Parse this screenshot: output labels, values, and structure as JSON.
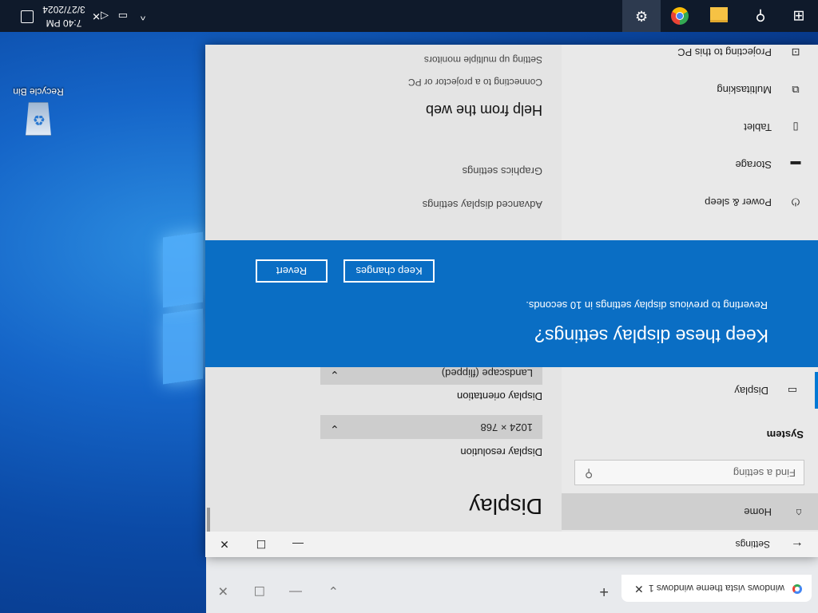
{
  "desktop": {
    "recycle_bin_label": "Recycle Bin"
  },
  "browser": {
    "tab_title": "windows vista theme windows 1(",
    "tab_close_glyph": "✕",
    "new_tab_glyph": "+",
    "controls": {
      "restore_down": "⌄",
      "minimize": "—",
      "maximize": "☐",
      "close": "✕"
    }
  },
  "settings": {
    "title": "Settings",
    "back_glyph": "←",
    "controls": {
      "minimize": "—",
      "maximize": "☐",
      "close": "✕"
    },
    "sidebar": {
      "home": "Home",
      "search_placeholder": "Find a setting",
      "section": "System",
      "items": [
        {
          "label": "Display",
          "icon": "display-icon"
        },
        {
          "label": "Power & sleep",
          "icon": "power-icon"
        },
        {
          "label": "Storage",
          "icon": "storage-icon"
        },
        {
          "label": "Tablet",
          "icon": "tablet-icon"
        },
        {
          "label": "Multitasking",
          "icon": "multitasking-icon"
        },
        {
          "label": "Projecting to this PC",
          "icon": "projecting-icon"
        }
      ]
    },
    "main": {
      "page_title": "Display",
      "resolution_label": "Display resolution",
      "resolution_value": "1024 × 768",
      "orientation_label": "Display orientation",
      "orientation_value": "Landscape (flipped)",
      "advanced_link": "Advanced display settings",
      "graphics_link": "Graphics settings",
      "help_heading": "Help from the web",
      "help_links": [
        "Connecting to a projector or PC",
        "Setting up multiple monitors"
      ]
    }
  },
  "dialog": {
    "title": "Keep these display settings?",
    "message": "Reverting to previous display settings in 10 seconds.",
    "keep_label": "Keep changes",
    "revert_label": "Revert",
    "accent": "#0a6ec4"
  },
  "taskbar": {
    "time": "7:40 PM",
    "date": "3/27/2024"
  },
  "screen_orientation": "rotated 180 degrees"
}
